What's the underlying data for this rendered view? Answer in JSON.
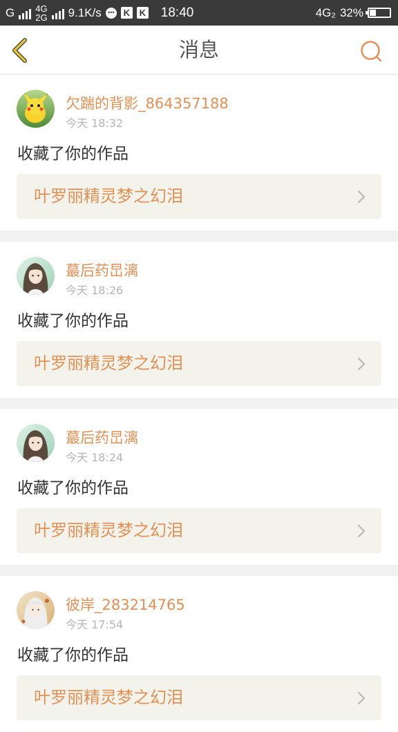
{
  "status_bar": {
    "carrier": "G",
    "net_top": "4G",
    "net_bottom": "2G",
    "speed": "9.1K/s",
    "time": "18:40",
    "network_right": "4G₂",
    "battery_percent": "32%",
    "battery_level": 0.32
  },
  "header": {
    "title": "消息"
  },
  "colors": {
    "accent": "#e29055",
    "back_icon": "#e2c33a",
    "card_bg": "#ffffff",
    "work_bg": "#f3f3eb",
    "page_bg": "#f2f2f2"
  },
  "messages": [
    {
      "username": "欠踹的背影_864357188",
      "time": "今天 18:32",
      "action": "收藏了你的作品",
      "work_title": "叶罗丽精灵梦之幻泪",
      "avatar": "pikachu-avatar"
    },
    {
      "username": "蕞后药旵漓",
      "time": "今天 18:26",
      "action": "收藏了你的作品",
      "work_title": "叶罗丽精灵梦之幻泪",
      "avatar": "anime-girl-avatar"
    },
    {
      "username": "蕞后药旵漓",
      "time": "今天 18:24",
      "action": "收藏了你的作品",
      "work_title": "叶罗丽精灵梦之幻泪",
      "avatar": "anime-girl-avatar"
    },
    {
      "username": "彼岸_283214765",
      "time": "今天 17:54",
      "action": "收藏了你的作品",
      "work_title": "叶罗丽精灵梦之幻泪",
      "avatar": "anime-white-hair-avatar"
    }
  ]
}
